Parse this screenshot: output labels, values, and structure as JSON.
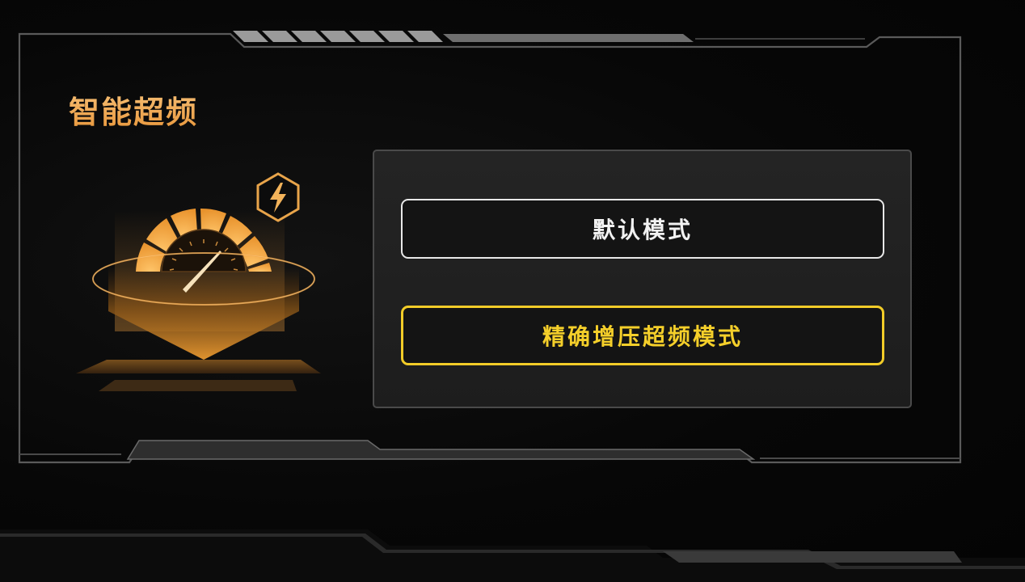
{
  "feature": {
    "title": "智能超频",
    "icons": {
      "bolt": "lightning-bolt-hexagon-icon",
      "gauge": "speedometer-gauge-icon"
    }
  },
  "modes": {
    "default_label": "默认模式",
    "boost_label": "精确增压超频模式",
    "selected": "boost"
  },
  "colors": {
    "accent_orange": "#f0a64a",
    "selected_yellow": "#f2cc28",
    "text_white": "#f2f2f2",
    "panel_bg": "#222222",
    "frame_line": "#5a5a5a"
  }
}
